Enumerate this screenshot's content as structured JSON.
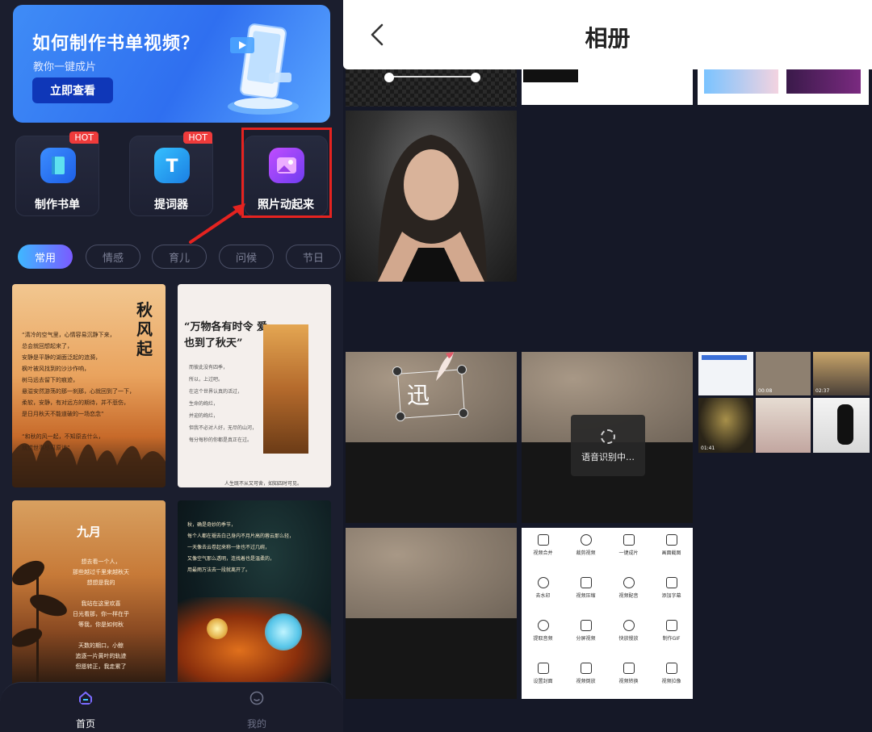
{
  "left": {
    "banner": {
      "title": "如何制作书单视频？",
      "subtitle": "教你一键成片",
      "button": "立即查看"
    },
    "tools": [
      {
        "label": "制作书单",
        "badge": "HOT",
        "icon": "book-icon",
        "color": "#2d7bf4"
      },
      {
        "label": "提词器",
        "badge": "HOT",
        "icon": "teleprompter-icon",
        "color": "#1aa9e8"
      },
      {
        "label": "照片动起来",
        "badge": "",
        "icon": "photo-animate-icon",
        "color": "#9b4cf1"
      }
    ],
    "chips": [
      "常用",
      "情感",
      "育儿",
      "问候",
      "节日"
    ],
    "cards": [
      {
        "title": "秋风起",
        "lines": [
          "“清冷的空气里，心情容易沉静下来，",
          "总会就回想起来了，",
          "安静是平静的湖面泛起的涟漪，",
          "枫叶被风找到的沙沙作响，",
          "树马远去留下的痕迹，",
          "悬溢安然游荡的那一刹那，心就回到了一下，",
          "柔软，安静，有对远方的期待，并不悲伤，",
          "是日月秋天不能道破的一场恋念”",
          "",
          "“和秋的风一起，不知原去什么，",
          "就觉世事尽可原谅”"
        ]
      },
      {
        "title": "“万物各有时令 爱也到了秋天”",
        "lines": [
          "而彼此没有四季，",
          "所以，上过吧。",
          "在这个世界认真的活过，",
          "生命的绚烂，",
          "并迎的绚烂，",
          "但我不必对人好，无尽的山河，",
          "每分每秒的你都是真正在过。",
          "",
          "人生既不从又可舍，如知四时可见。"
        ]
      },
      {
        "title": "九月",
        "lines": [
          "想去看一个人，",
          "那些越过千里来越秋天",
          "想想是我的",
          "",
          "我站在这里欢喜",
          "日光看那，你一样在乎",
          "等我，你是如何秋",
          "",
          "天数的期口，小鲸",
          "追逐一片黄叶的轨迹",
          "但愿转正，我走累了"
        ]
      },
      {
        "title": "",
        "lines": [
          "秋，确是奇妙的季节，",
          "每个人都在褪去白己身内不月片高的蓉云那么轻，",
          "一天像去云卷起来称一体也不过几碗，",
          "又像空气那么透明，连找着也是温柔的，",
          "用最雨万法去一段就离开了。"
        ]
      }
    ],
    "nav": [
      {
        "label": "首页",
        "icon": "home-icon"
      },
      {
        "label": "我的",
        "icon": "profile-icon"
      }
    ]
  },
  "right": {
    "header": {
      "title": "相册"
    },
    "overlay_char": "迅",
    "toast": "语音识别中…",
    "durations": [
      "00:08",
      "02:37",
      "01:41"
    ],
    "menu": [
      "视频合并",
      "裁剪视频",
      "一键成片",
      "画面截图",
      "去水印",
      "视频压缩",
      "视频配音",
      "添加字幕",
      "提取音频",
      "分屏视频",
      "快放慢放",
      "制作GIF",
      "设置封面",
      "视频倒放",
      "视频转换",
      "视频拉像",
      "视频变音",
      "视频分割",
      "画中画",
      "文字视频"
    ]
  },
  "colors": {
    "accent_red": "#e52320",
    "hot_badge": "#ef3b3b",
    "chip_active_from": "#3fb8ff",
    "chip_active_to": "#7a5bff"
  }
}
